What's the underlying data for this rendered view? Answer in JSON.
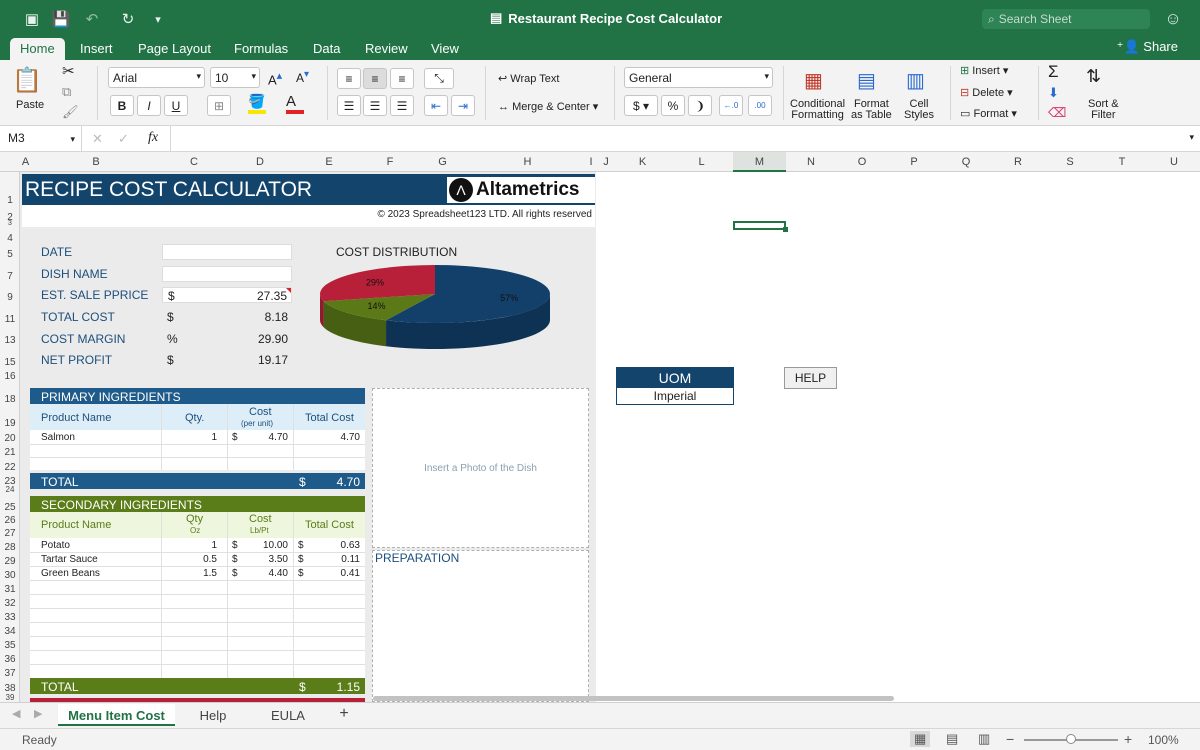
{
  "titlebar": {
    "title": "Restaurant Recipe Cost Calculator",
    "search_placeholder": "Search Sheet"
  },
  "menu_tabs": [
    "Home",
    "Insert",
    "Page Layout",
    "Formulas",
    "Data",
    "Review",
    "View"
  ],
  "share_label": "Share",
  "ribbon": {
    "paste": "Paste",
    "font_name": "Arial",
    "font_size": "10",
    "wrap_text": "Wrap Text",
    "merge_center": "Merge & Center",
    "number_format": "General",
    "conditional_formatting": [
      "Conditional",
      "Formatting"
    ],
    "format_as_table": [
      "Format",
      "as Table"
    ],
    "cell_styles": [
      "Cell",
      "Styles"
    ],
    "insert": "Insert",
    "delete": "Delete",
    "format": "Format",
    "sort_filter": [
      "Sort &",
      "Filter"
    ]
  },
  "formula_bar": {
    "name_box": "M3",
    "fx": "fx"
  },
  "columns": [
    "A",
    "B",
    "C",
    "D",
    "E",
    "F",
    "G",
    "H",
    "I",
    "J",
    "K",
    "L",
    "M",
    "N",
    "O",
    "P",
    "Q",
    "R",
    "S",
    "T",
    "U"
  ],
  "rows": [
    "1",
    "2",
    "3",
    "4",
    "5",
    "7",
    "9",
    "11",
    "13",
    "15",
    "16",
    "18",
    "19",
    "20",
    "21",
    "22",
    "23",
    "24",
    "25",
    "26",
    "27",
    "28",
    "29",
    "30",
    "31",
    "32",
    "33",
    "34",
    "35",
    "36",
    "37",
    "38",
    "39"
  ],
  "sheet": {
    "title": "RECIPE COST CALCULATOR",
    "logo": "Altametrics",
    "copyright": "© 2023 Spreadsheet123 LTD. All rights reserved",
    "fields": [
      {
        "label": "DATE",
        "unit": "",
        "value": ""
      },
      {
        "label": "DISH NAME",
        "unit": "",
        "value": ""
      },
      {
        "label": "EST. SALE PPRICE",
        "unit": "$",
        "value": "27.35"
      },
      {
        "label": "TOTAL COST",
        "unit": "$",
        "value": "8.18"
      },
      {
        "label": "COST MARGIN",
        "unit": "%",
        "value": "29.90"
      },
      {
        "label": "NET PROFIT",
        "unit": "$",
        "value": "19.17"
      }
    ],
    "chart_title": "COST DISTRIBUTION",
    "primary": {
      "header": "PRIMARY INGREDIENTS",
      "cols": [
        "Product Name",
        "Qty.",
        "Cost",
        "(per unit)",
        "Total Cost"
      ],
      "rows": [
        {
          "name": "Salmon",
          "qty": "1",
          "cost_sym": "$",
          "cost": "4.70",
          "total": "4.70"
        }
      ],
      "total_label": "TOTAL",
      "total_sym": "$",
      "total_value": "4.70"
    },
    "secondary": {
      "header": "SECONDARY INGREDIENTS",
      "cols": [
        "Product Name",
        "Qty",
        "Oz",
        "Cost",
        "Lb/Pt",
        "Total Cost"
      ],
      "rows": [
        {
          "name": "Potato",
          "qty": "1",
          "cost_sym": "$",
          "cost": "10.00",
          "total_sym": "$",
          "total": "0.63"
        },
        {
          "name": "Tartar Sauce",
          "qty": "0.5",
          "cost_sym": "$",
          "cost": "3.50",
          "total_sym": "$",
          "total": "0.11"
        },
        {
          "name": "Green Beans",
          "qty": "1.5",
          "cost_sym": "$",
          "cost": "4.40",
          "total_sym": "$",
          "total": "0.41"
        }
      ],
      "total_label": "TOTAL",
      "total_sym": "$",
      "total_value": "1.15"
    },
    "photo_placeholder": "Insert a Photo of the Dish",
    "preparation": "PREPARATION"
  },
  "uom": {
    "header": "UOM",
    "value": "Imperial"
  },
  "help_button": "HELP",
  "sheet_tabs": [
    "Menu Item Cost",
    "Help",
    "EULA",
    "+"
  ],
  "status": {
    "ready": "Ready",
    "zoom": "100%"
  },
  "chart_data": {
    "type": "pie",
    "title": "COST DISTRIBUTION",
    "slices": [
      {
        "label": "57%",
        "value": 57,
        "color": "#12406a"
      },
      {
        "label": "14%",
        "value": 14,
        "color": "#5b7a17"
      },
      {
        "label": "29%",
        "value": 29,
        "color": "#b8203a"
      }
    ]
  }
}
